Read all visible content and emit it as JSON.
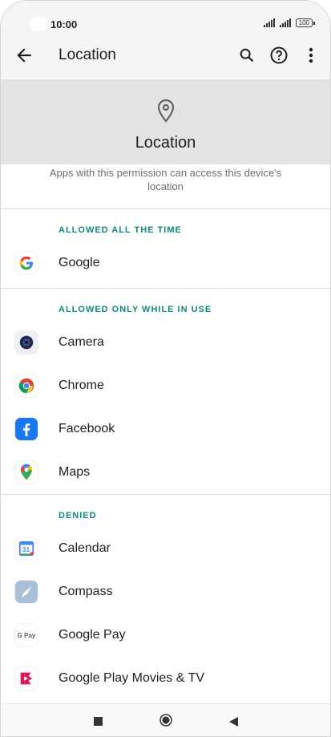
{
  "status": {
    "time": "10:00",
    "battery": "100"
  },
  "appbar": {
    "title": "Location"
  },
  "header": {
    "title": "Location",
    "description": "Apps with this permission can access this device's location"
  },
  "sections": [
    {
      "title": "ALLOWED ALL THE TIME",
      "apps": [
        {
          "name": "Google",
          "icon": "google-icon"
        }
      ]
    },
    {
      "title": "ALLOWED ONLY WHILE IN USE",
      "apps": [
        {
          "name": "Camera",
          "icon": "camera-icon"
        },
        {
          "name": "Chrome",
          "icon": "chrome-icon"
        },
        {
          "name": "Facebook",
          "icon": "facebook-icon"
        },
        {
          "name": "Maps",
          "icon": "maps-icon"
        }
      ]
    },
    {
      "title": "DENIED",
      "apps": [
        {
          "name": "Calendar",
          "icon": "calendar-icon"
        },
        {
          "name": "Compass",
          "icon": "compass-icon"
        },
        {
          "name": "Google Pay",
          "icon": "google-pay-icon"
        },
        {
          "name": "Google Play Movies & TV",
          "icon": "play-movies-icon"
        }
      ]
    }
  ],
  "calendar_day": "31",
  "gpay_text": "G Pay",
  "colors": {
    "accent": "#12877d",
    "header_bg": "#e3e3e3"
  }
}
